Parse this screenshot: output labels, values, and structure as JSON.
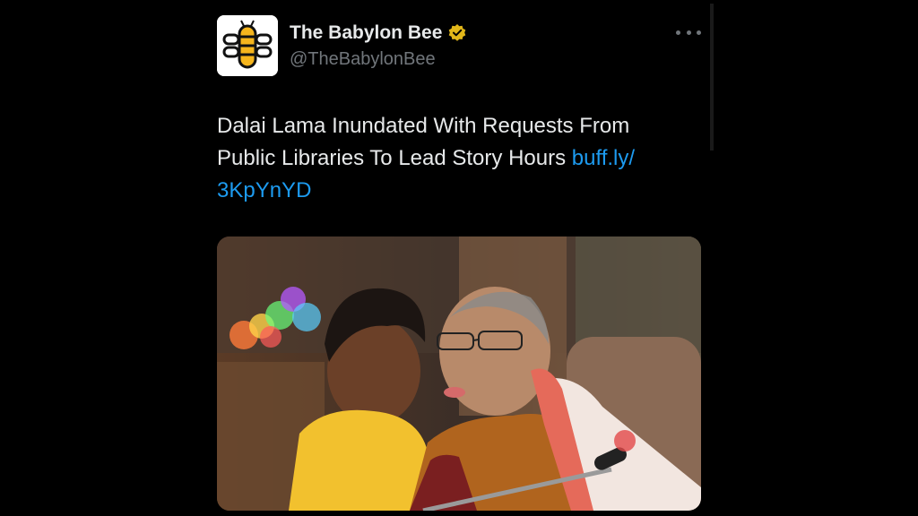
{
  "account": {
    "display_name": "The Babylon Bee",
    "handle": "@TheBabylonBee",
    "verified_color": "#e2b719",
    "avatar_icon": "bee-logo-icon"
  },
  "tweet": {
    "text": "Dalai Lama Inundated With Requests From Public Libraries To Lead Story Hours ",
    "link_text": "buff.ly/\n3KpYnYD",
    "link_color": "#1d9bf0"
  },
  "more_icon": "more-options-icon",
  "media": {
    "type": "photo"
  }
}
